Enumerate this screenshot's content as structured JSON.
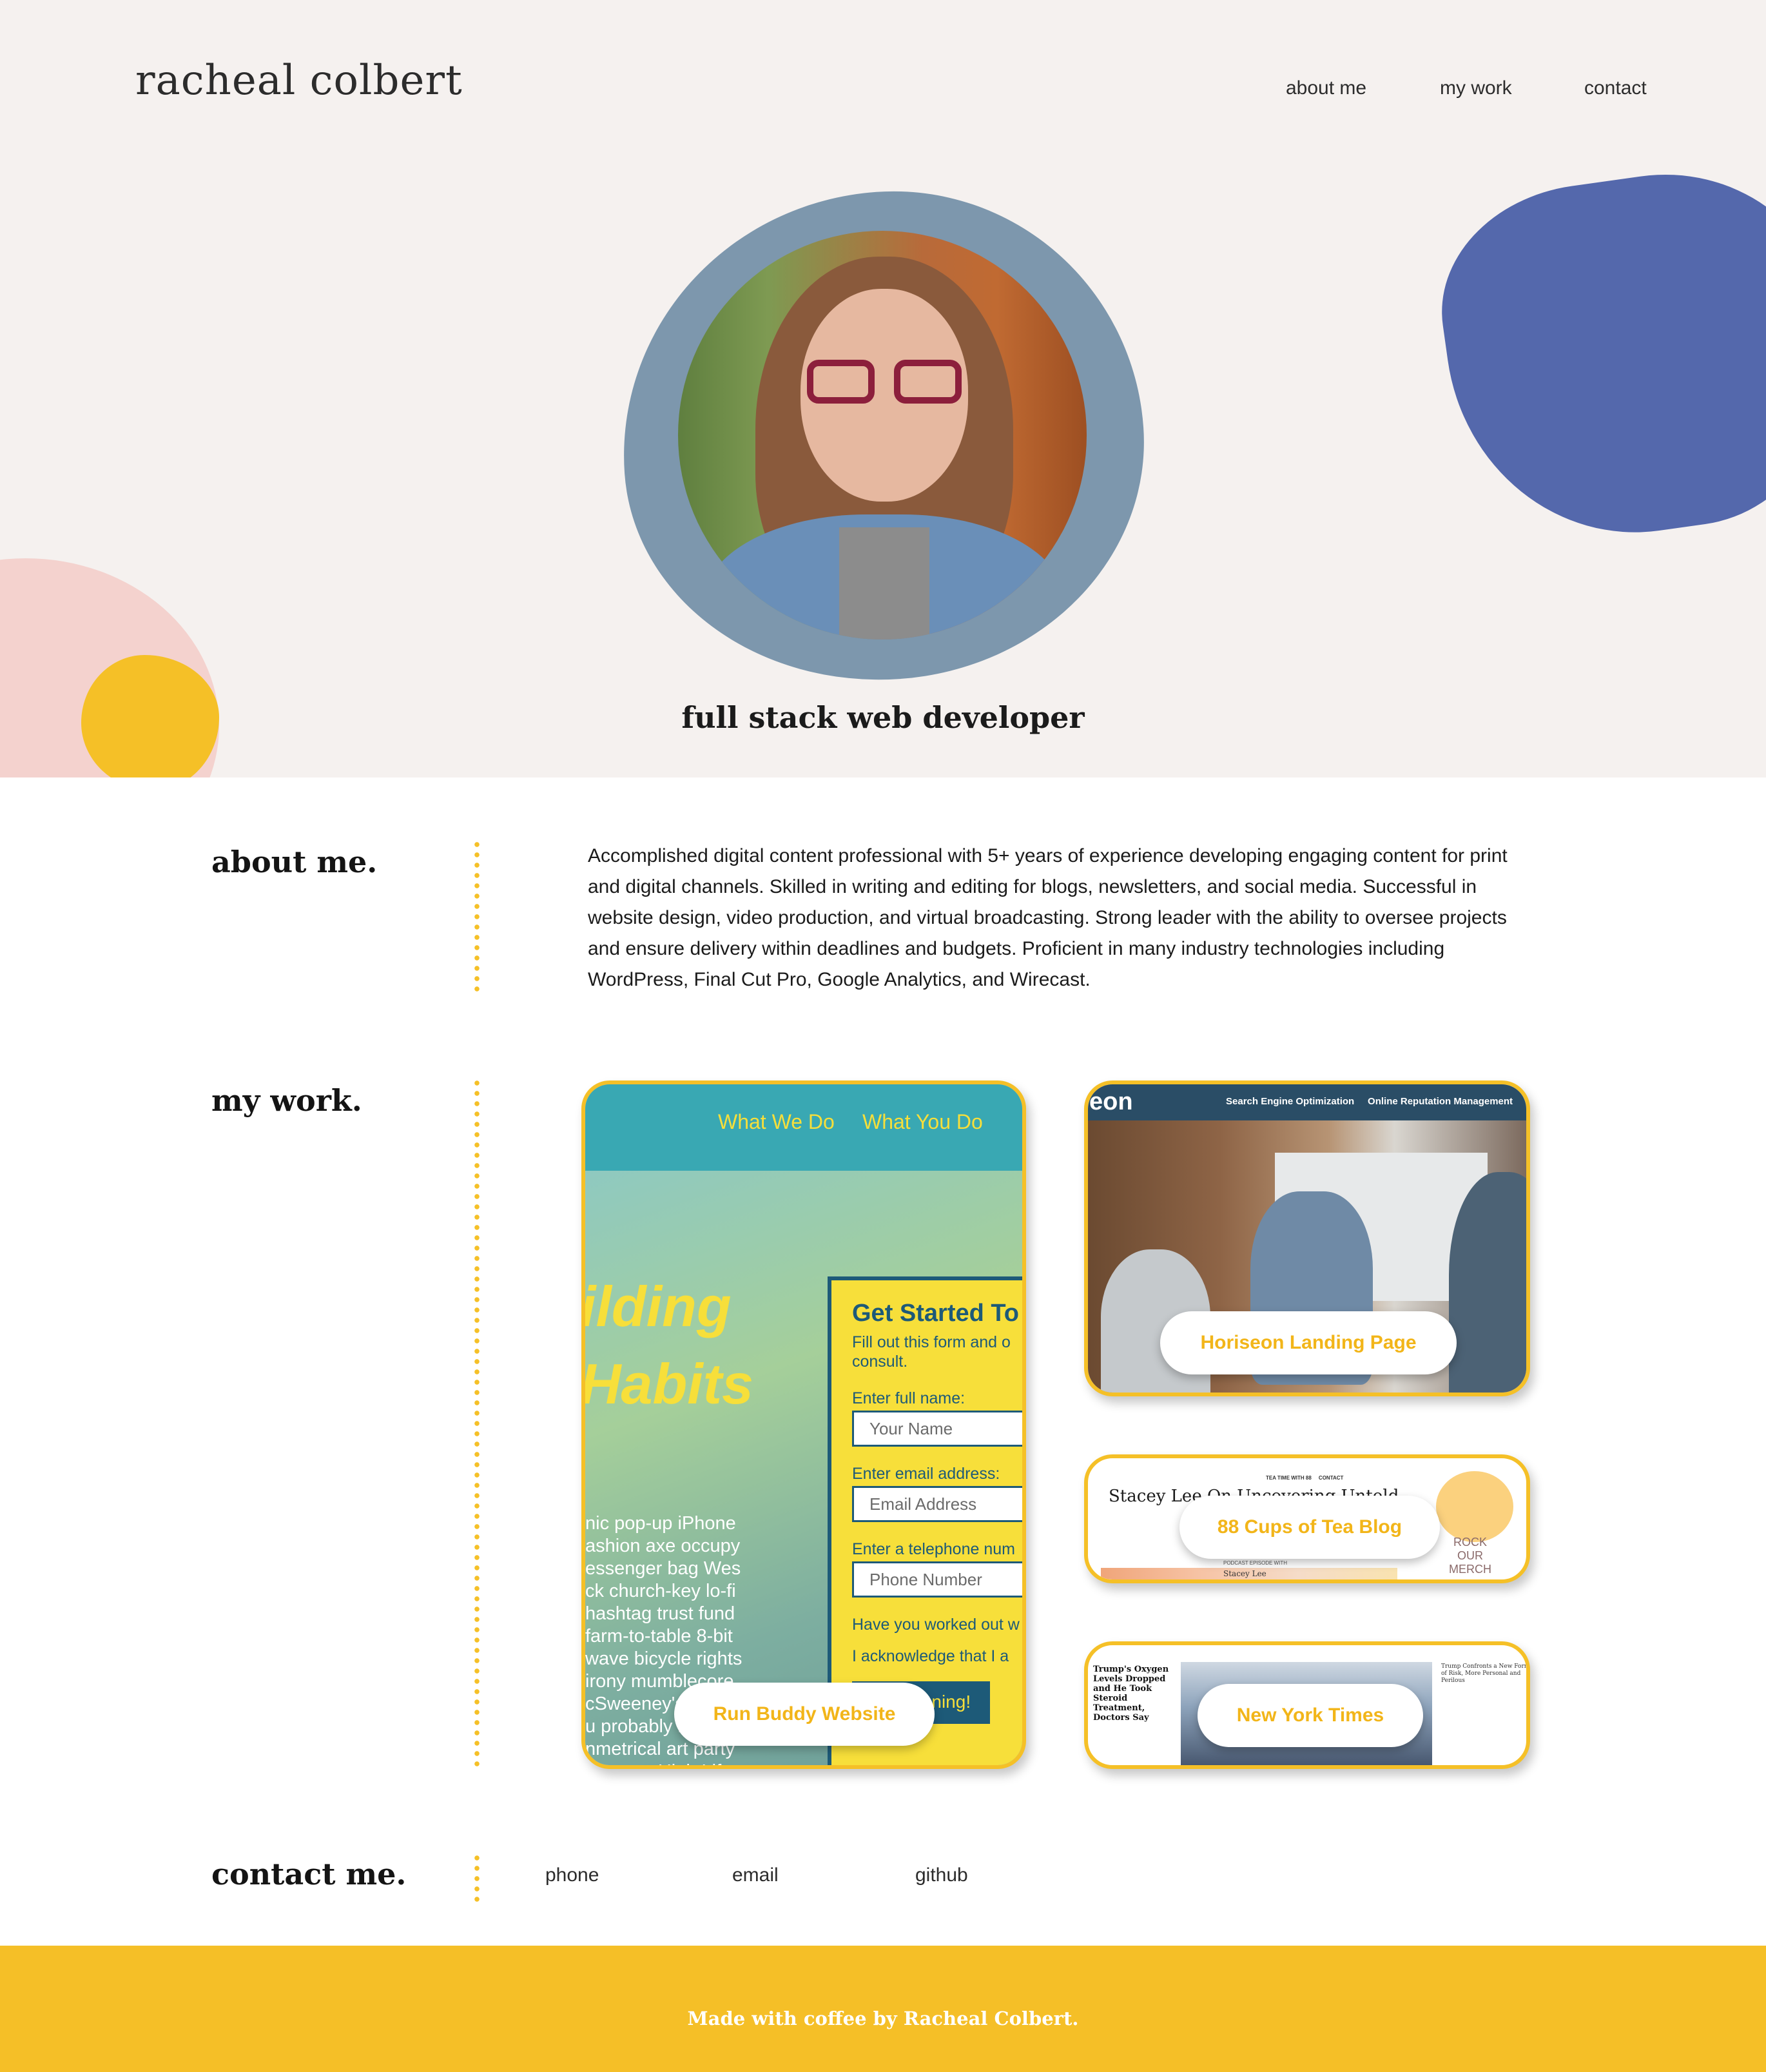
{
  "header": {
    "brand": "racheal colbert",
    "nav": [
      "about me",
      "my work",
      "contact"
    ]
  },
  "hero": {
    "tagline": "full stack web developer"
  },
  "about": {
    "title": "about me.",
    "text": "Accomplished digital content professional with 5+ years of experience developing engaging content for print and digital channels. Skilled in writing and editing for blogs, newsletters, and social media. Successful in website design, video production, and virtual broadcasting. Strong leader with the ability to oversee projects and ensure delivery within deadlines and budgets. Proficient in many industry technologies including WordPress, Final Cut Pro, Google Analytics, and Wirecast."
  },
  "work": {
    "title": "my work.",
    "projects": [
      {
        "label": "Run Buddy Website",
        "preview": {
          "nav": [
            "What We Do",
            "What You Do"
          ],
          "headline": [
            "ilding",
            "Habits"
          ],
          "lorem": "nic pop-up iPhone\nashion axe occupy\nessenger bag Wes\nck church-key lo-fi\nhashtag trust fund\nfarm-to-table 8-bit\nwave bicycle rights\nirony mumblecore\ncSweeney's bitters\nu probably haven't\nnmetrical art party\nterpress High Life",
          "form_title": "Get Started To",
          "form_sub": "Fill out this form and o\nconsult.",
          "name_label": "Enter full name:",
          "name_placeholder": "Your Name",
          "email_label": "Enter email address:",
          "email_placeholder": "Email Address",
          "phone_label": "Enter a telephone num",
          "phone_placeholder": "Phone Number",
          "q1": "Have you worked out w",
          "q2": "I acknowledge that I a",
          "submit": "Get running!"
        }
      },
      {
        "label": "Horiseon Landing Page",
        "preview": {
          "logo": "eon",
          "links": "Search Engine Optimization     Online Reputation Management     Social Me"
        }
      },
      {
        "label": "88 Cups of Tea Blog",
        "preview": {
          "title": "Stacey Lee On Uncovering Untold",
          "top_links": "TEA TIME WITH 88     CONTACT",
          "merch": "ROCK\nOUR\nMERCH",
          "podcast": "PODCAST EPISODE WITH",
          "guest": "Stacey Lee"
        }
      },
      {
        "label": "New York Times",
        "preview": {
          "headline": "Trump's Oxygen Levels Dropped and He Took Steroid Treatment, Doctors Say",
          "side": "Trump Confronts a New Form of Risk, More Personal and Perilous"
        }
      }
    ]
  },
  "contact": {
    "title": "contact me.",
    "links": [
      "phone",
      "email",
      "github"
    ]
  },
  "footer": {
    "text": "Made with coffee by Racheal Colbert."
  },
  "colors": {
    "accent_yellow": "#f5bf27",
    "blob_blue": "#5468ac",
    "ring_blue": "#7d97ad",
    "hero_bg": "#f5f1ef",
    "blob_pink": "#f4d2ce"
  }
}
